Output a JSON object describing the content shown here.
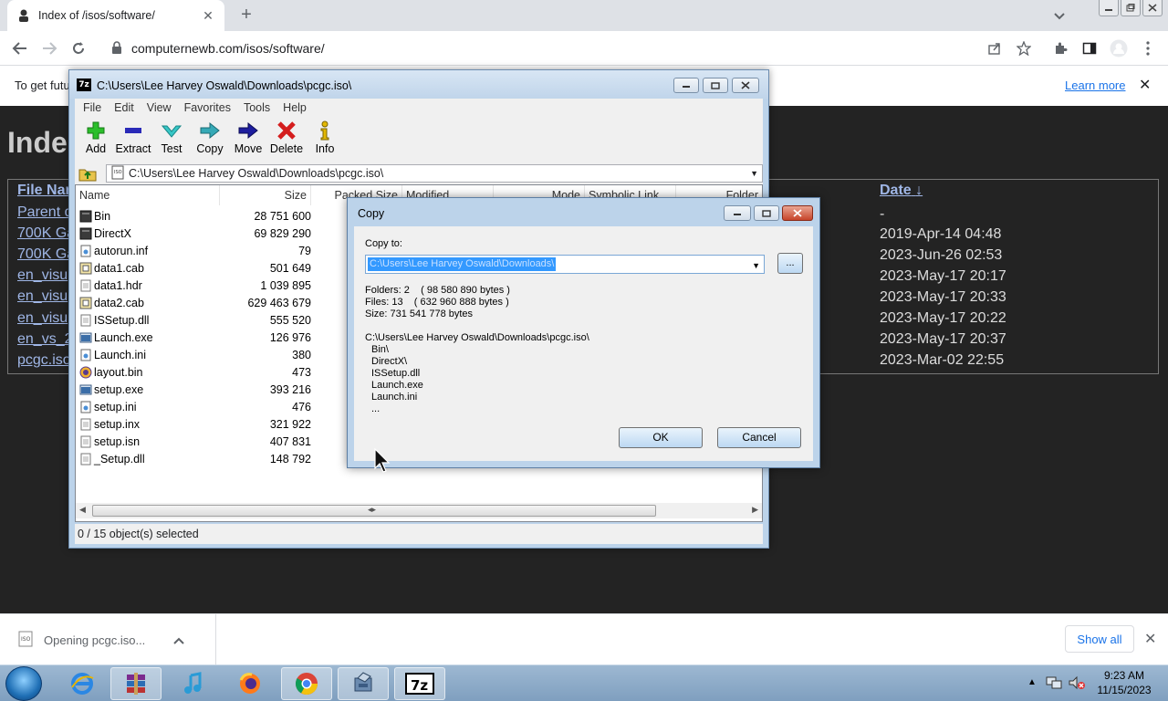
{
  "browser": {
    "tab_title": "Index of /isos/software/",
    "url": "computernewb.com/isos/software/",
    "infobar_text": "To get futu",
    "infobar_link": "Learn more"
  },
  "page": {
    "heading": "Inde",
    "col_name": "File Nar",
    "col_date": "Date",
    "date_sort_arrow": "↓",
    "rows": [
      {
        "name": "Parent d",
        "date": "-"
      },
      {
        "name": "700K Ga",
        "date": "2019-Apr-14 04:48"
      },
      {
        "name": "700K Ga",
        "date": "2023-Jun-26 02:53"
      },
      {
        "name": "en_visu",
        "date": "2023-May-17 20:17"
      },
      {
        "name": "en_visu",
        "date": "2023-May-17 20:33"
      },
      {
        "name": "en_visu",
        "date": "2023-May-17 20:22"
      },
      {
        "name": "en_vs_2",
        "date": "2023-May-17 20:37"
      },
      {
        "name": "pcgc.iso",
        "date": "2023-Mar-02 22:55"
      }
    ]
  },
  "downloads": {
    "item": "Opening pcgc.iso...",
    "show_all": "Show all"
  },
  "sevenzip": {
    "title": "C:\\Users\\Lee Harvey Oswald\\Downloads\\pcgc.iso\\",
    "menu": [
      "File",
      "Edit",
      "View",
      "Favorites",
      "Tools",
      "Help"
    ],
    "tools": [
      "Add",
      "Extract",
      "Test",
      "Copy",
      "Move",
      "Delete",
      "Info"
    ],
    "address": "C:\\Users\\Lee Harvey Oswald\\Downloads\\pcgc.iso\\",
    "columns": {
      "name": "Name",
      "size": "Size",
      "packed": "Packed Size",
      "modified": "Modified",
      "mode": "Mode",
      "symlink": "Symbolic Link",
      "folder": "Folder"
    },
    "files": [
      {
        "name": "Bin",
        "size": "28 751 600",
        "type": "folder"
      },
      {
        "name": "DirectX",
        "size": "69 829 290",
        "type": "folder"
      },
      {
        "name": "autorun.inf",
        "size": "79",
        "type": "ini"
      },
      {
        "name": "data1.cab",
        "size": "501 649",
        "type": "cab"
      },
      {
        "name": "data1.hdr",
        "size": "1 039 895",
        "type": "file"
      },
      {
        "name": "data2.cab",
        "size": "629 463 679",
        "type": "cab"
      },
      {
        "name": "ISSetup.dll",
        "size": "555 520",
        "type": "file"
      },
      {
        "name": "Launch.exe",
        "size": "126 976",
        "type": "exe"
      },
      {
        "name": "Launch.ini",
        "size": "380",
        "type": "ini"
      },
      {
        "name": "layout.bin",
        "size": "473",
        "type": "bin"
      },
      {
        "name": "setup.exe",
        "size": "393 216",
        "type": "exe"
      },
      {
        "name": "setup.ini",
        "size": "476",
        "type": "ini"
      },
      {
        "name": "setup.inx",
        "size": "321 922",
        "type": "file"
      },
      {
        "name": "setup.isn",
        "size": "407 831",
        "type": "file"
      },
      {
        "name": "_Setup.dll",
        "size": "148 792",
        "type": "file"
      }
    ],
    "status": "0 / 15 object(s) selected"
  },
  "copy_dialog": {
    "title": "Copy",
    "copy_to_label": "Copy to:",
    "destination": "C:\\Users\\Lee Harvey Oswald\\Downloads\\",
    "browse": "...",
    "folders": "Folders: 2    ( 98 580 890 bytes )",
    "files": "Files: 13    ( 632 960 888 bytes )",
    "size": "Size: 731 541 778 bytes",
    "source_path": "C:\\Users\\Lee Harvey Oswald\\Downloads\\pcgc.iso\\",
    "items": [
      "Bin\\",
      "DirectX\\",
      "ISSetup.dll",
      "Launch.exe",
      "Launch.ini",
      "..."
    ],
    "ok": "OK",
    "cancel": "Cancel"
  },
  "taskbar": {
    "time": "9:23 AM",
    "date": "11/15/2023",
    "apps": [
      "internet-explorer",
      "winrar",
      "itunes",
      "firefox",
      "chrome",
      "setup",
      "7-zip"
    ]
  }
}
